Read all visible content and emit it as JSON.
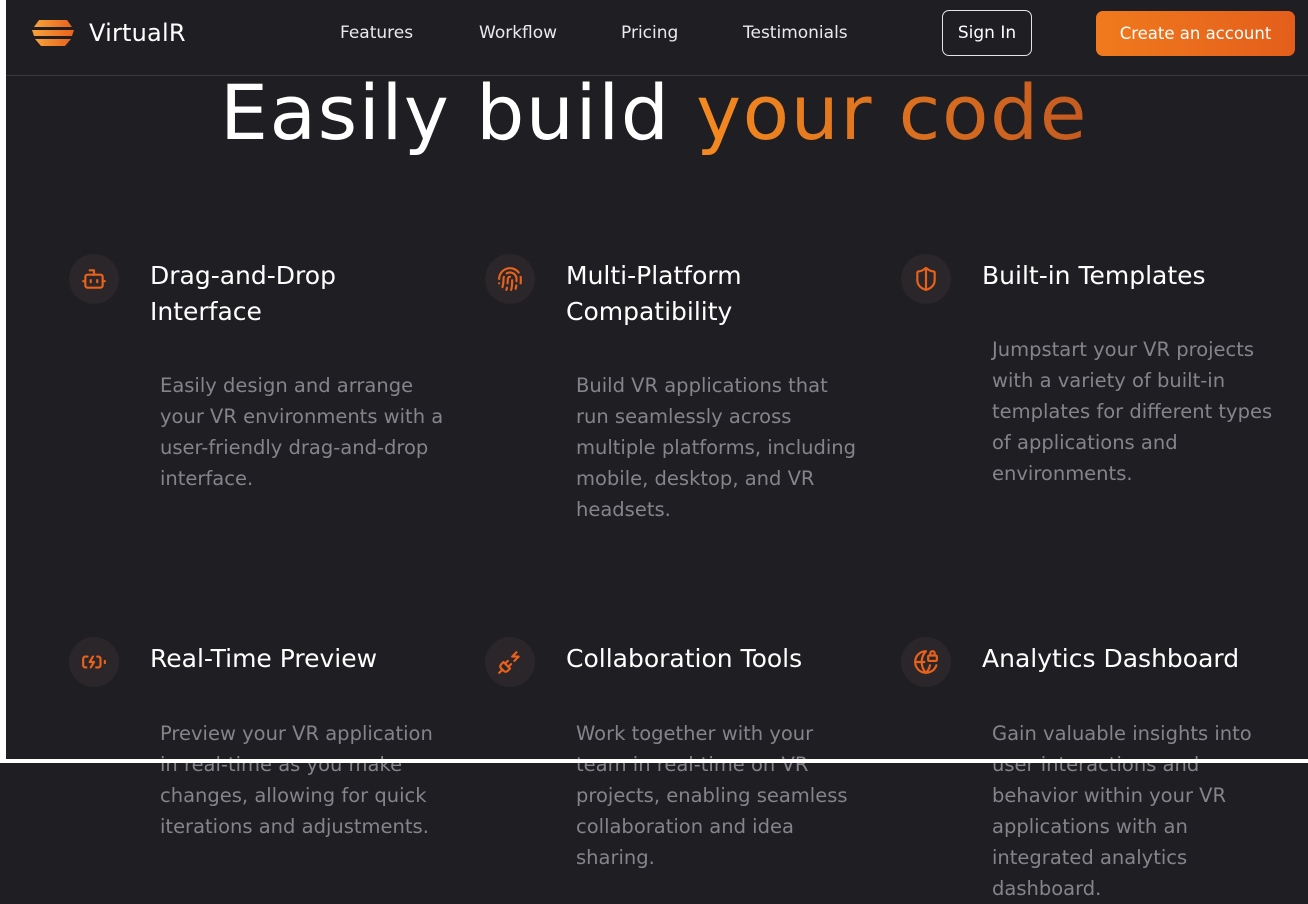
{
  "brand": {
    "name": "VirtualR",
    "accent_color": "#f07a1d"
  },
  "nav": {
    "links": [
      "Features",
      "Workflow",
      "Pricing",
      "Testimonials"
    ],
    "sign_in": "Sign In",
    "create_account": "Create an account"
  },
  "hero": {
    "title_part1": "Easily build",
    "title_part2": "your code"
  },
  "features": [
    {
      "icon": "bot-icon",
      "title": "Drag-and-Drop Interface",
      "description": "Easily design and arrange your VR environments with a user-friendly drag-and-drop interface."
    },
    {
      "icon": "fingerprint-icon",
      "title": "Multi-Platform Compatibility",
      "description": "Build VR applications that run seamlessly across multiple platforms, including mobile, desktop, and VR headsets."
    },
    {
      "icon": "shield-half-icon",
      "title": "Built-in Templates",
      "description": "Jumpstart your VR projects with a variety of built-in templates for different types of applications and environments."
    },
    {
      "icon": "battery-charging-icon",
      "title": "Real-Time Preview",
      "description": "Preview your VR application in real-time as you make changes, allowing for quick iterations and adjustments."
    },
    {
      "icon": "plug-zap-icon",
      "title": "Collaboration Tools",
      "description": "Work together with your team in real-time on VR projects, enabling seamless collaboration and idea sharing."
    },
    {
      "icon": "globe-lock-icon",
      "title": "Analytics Dashboard",
      "description": "Gain valuable insights into user interactions and behavior within your VR applications with an integrated analytics dashboard."
    }
  ]
}
